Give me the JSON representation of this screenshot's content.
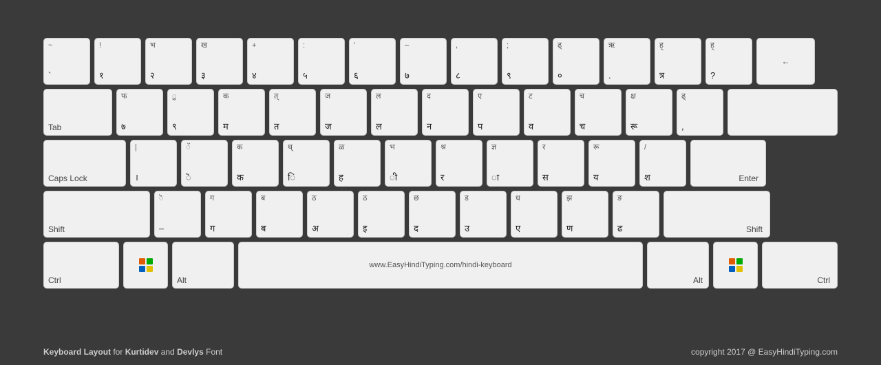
{
  "keyboard": {
    "rows": [
      {
        "keys": [
          {
            "top": "~",
            "bottom": "`",
            "width": "standard"
          },
          {
            "top": "!",
            "bottom": "१",
            "width": "standard"
          },
          {
            "top": "भ",
            "bottom": "२",
            "width": "standard"
          },
          {
            "top": "ख",
            "bottom": "३",
            "width": "standard"
          },
          {
            "top": "+",
            "bottom": "४",
            "width": "standard"
          },
          {
            "top": ":",
            "bottom": "५",
            "width": "standard"
          },
          {
            "top": "'",
            "bottom": "६",
            "width": "standard"
          },
          {
            "top": "–",
            "bottom": "७",
            "width": "standard"
          },
          {
            "top": ",",
            "bottom": "८",
            "width": "standard"
          },
          {
            "top": ";",
            "bottom": "९",
            "width": "standard"
          },
          {
            "top": "ढ्",
            "bottom": "०",
            "width": "standard"
          },
          {
            "top": "ऋ",
            "bottom": ".",
            "width": "standard"
          },
          {
            "top": "ह्",
            "bottom": "त्र",
            "width": "standard"
          },
          {
            "top": "ह्",
            "bottom": "?",
            "width": "standard"
          },
          {
            "top": "←",
            "bottom": "",
            "width": "backspace",
            "label": "←"
          }
        ]
      },
      {
        "keys": [
          {
            "top": "",
            "bottom": "Tab",
            "width": "tab",
            "label": "Tab"
          },
          {
            "top": "फ",
            "bottom": "७",
            "width": "standard"
          },
          {
            "top": "ु",
            "bottom": "९",
            "width": "standard"
          },
          {
            "top": "क",
            "bottom": "म",
            "width": "standard"
          },
          {
            "top": "त्",
            "bottom": "त",
            "width": "standard"
          },
          {
            "top": "ज",
            "bottom": "ज",
            "width": "standard"
          },
          {
            "top": "ल",
            "bottom": "ल",
            "width": "standard"
          },
          {
            "top": "द",
            "bottom": "न",
            "width": "standard"
          },
          {
            "top": "ए",
            "bottom": "प",
            "width": "standard"
          },
          {
            "top": "ट",
            "bottom": "व",
            "width": "standard"
          },
          {
            "top": "च",
            "bottom": "च",
            "width": "standard"
          },
          {
            "top": "क्ष",
            "bottom": "रू",
            "width": "standard"
          },
          {
            "top": "ढ्",
            "bottom": ",",
            "width": "standard"
          },
          {
            "top": "",
            "bottom": "",
            "width": "enter-top",
            "label": ""
          }
        ]
      },
      {
        "keys": [
          {
            "top": "",
            "bottom": "Caps Lock",
            "width": "caps",
            "label": "Caps Lock"
          },
          {
            "top": "|",
            "bottom": "।",
            "width": "standard"
          },
          {
            "top": "ॅ",
            "bottom": "ॆ",
            "width": "standard"
          },
          {
            "top": "क",
            "bottom": "क",
            "width": "standard"
          },
          {
            "top": "थ्",
            "bottom": "ि",
            "width": "standard"
          },
          {
            "top": "ळ",
            "bottom": "ह",
            "width": "standard"
          },
          {
            "top": "भ",
            "bottom": "ी",
            "width": "standard"
          },
          {
            "top": "श्र",
            "bottom": "र",
            "width": "standard"
          },
          {
            "top": "ज्ञ",
            "bottom": "ा",
            "width": "standard"
          },
          {
            "top": "र",
            "bottom": "स",
            "width": "standard"
          },
          {
            "top": "रू",
            "bottom": "य",
            "width": "standard"
          },
          {
            "top": "/",
            "bottom": "श",
            "width": "standard"
          },
          {
            "top": "",
            "bottom": "Enter",
            "width": "enter",
            "label": "Enter"
          }
        ]
      },
      {
        "keys": [
          {
            "top": "",
            "bottom": "Shift",
            "width": "shift-l",
            "label": "Shift"
          },
          {
            "top": "ॆ",
            "bottom": "–",
            "width": "standard"
          },
          {
            "top": "ग",
            "bottom": "ग",
            "width": "standard"
          },
          {
            "top": "ब",
            "bottom": "ब",
            "width": "standard"
          },
          {
            "top": "ठ",
            "bottom": "अ",
            "width": "standard"
          },
          {
            "top": "ठ",
            "bottom": "इ",
            "width": "standard"
          },
          {
            "top": "छ",
            "bottom": "द",
            "width": "standard"
          },
          {
            "top": "ड",
            "bottom": "उ",
            "width": "standard"
          },
          {
            "top": "ध",
            "bottom": "ए",
            "width": "standard"
          },
          {
            "top": "झ",
            "bottom": "ण",
            "width": "standard"
          },
          {
            "top": "ङ",
            "bottom": "ढ",
            "width": "standard"
          },
          {
            "top": "",
            "bottom": "Shift",
            "width": "shift-r",
            "label": "Shift"
          }
        ]
      },
      {
        "keys": [
          {
            "top": "",
            "bottom": "Ctrl",
            "width": "ctrl",
            "label": "Ctrl"
          },
          {
            "top": "",
            "bottom": "",
            "width": "win",
            "label": "win"
          },
          {
            "top": "",
            "bottom": "Alt",
            "width": "alt",
            "label": "Alt"
          },
          {
            "top": "",
            "bottom": "www.EasyHindiTyping.com/hindi-keyboard",
            "width": "space"
          },
          {
            "top": "",
            "bottom": "Alt",
            "width": "alt",
            "label": "Alt"
          },
          {
            "top": "",
            "bottom": "",
            "width": "win",
            "label": "win"
          },
          {
            "top": "",
            "bottom": "Ctrl",
            "width": "ctrl",
            "label": "Ctrl"
          }
        ]
      }
    ],
    "footer": {
      "left": "Keyboard Layout for Kurtidev and Devlys Font",
      "right": "copyright 2017 @ EasyHindiTyping.com"
    }
  }
}
